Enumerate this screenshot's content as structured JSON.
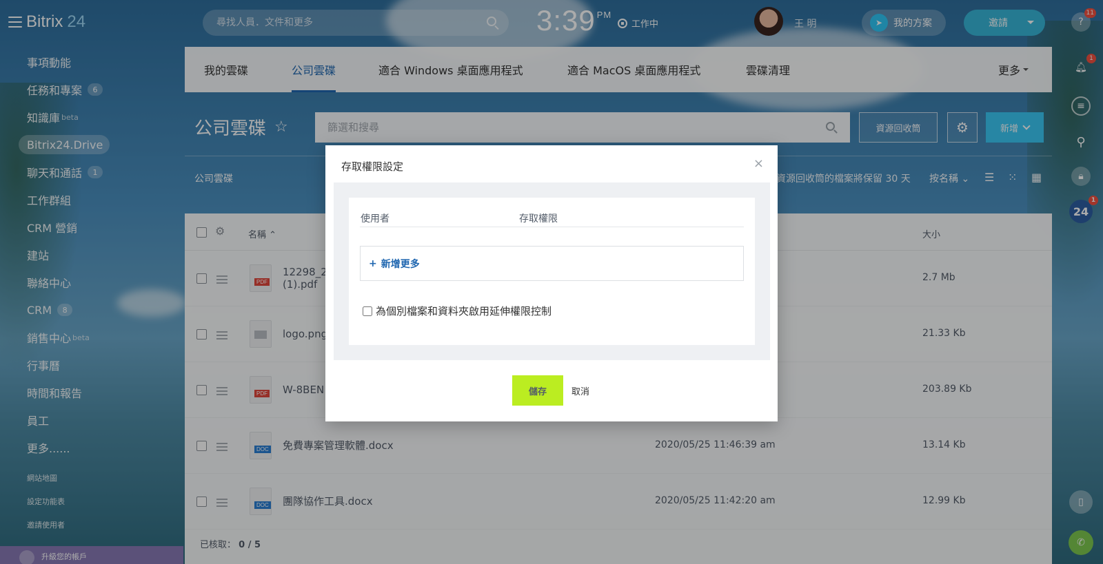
{
  "topbar": {
    "brand_main": "Bitrix",
    "brand_num": "24",
    "search_placeholder": "尋找人員．文件和更多",
    "clock_time": "3:39",
    "clock_ampm": "PM",
    "work_status": "工作中",
    "username": "王 明",
    "plan_label": "我的方案",
    "invite_label": "邀請"
  },
  "rail": {
    "help_badge": "11",
    "notify_badge": "1",
    "b24_label": "24",
    "b24_badge": "1"
  },
  "leftmenu": {
    "items": [
      {
        "label": "事項動能"
      },
      {
        "label": "任務和專案",
        "count": "6"
      },
      {
        "label": "知識庫",
        "sup": "beta"
      },
      {
        "label": "Bitrix24.Drive"
      },
      {
        "label": "聊天和通話",
        "count": "1"
      },
      {
        "label": "工作群組"
      },
      {
        "label": "CRM 營銷"
      },
      {
        "label": "建站"
      },
      {
        "label": "聯絡中心"
      },
      {
        "label": "CRM",
        "count": "8"
      },
      {
        "label": "銷售中心",
        "sup": "beta"
      },
      {
        "label": "行事曆"
      },
      {
        "label": "時間和報告"
      },
      {
        "label": "員工"
      },
      {
        "label": "更多......"
      }
    ],
    "sitemap": "網站地圖",
    "settings": "設定功能表",
    "invite_users": "邀請使用者",
    "upgrade": "升級您的帳戶"
  },
  "tabs": {
    "items": [
      "我的雲碟",
      "公司雲碟",
      "適合 Windows 桌面應用程式",
      "適合 MacOS 桌面應用程式",
      "雲碟清理"
    ],
    "more": "更多"
  },
  "page": {
    "title": "公司雲碟",
    "filter_placeholder": "篩選和搜尋",
    "recycle_btn": "資源回收筒",
    "new_btn": "新增",
    "breadcrumb": "公司雲碟",
    "keep_note": "資源回收筒的檔案將保留 30 天",
    "sort_label": "按名稱"
  },
  "table": {
    "col_name": "名稱",
    "col_size": "大小",
    "rows": [
      {
        "name1": "12298_2",
        "name2": "(1).pdf",
        "type": "PDF",
        "date": "",
        "size": "2.7 Mb"
      },
      {
        "name1": "logo.png",
        "name2": "",
        "type": "IMG",
        "date": "",
        "size": "21.33 Kb"
      },
      {
        "name1": "W-8BEN",
        "name2": "",
        "type": "PDF",
        "date": "",
        "size": "203.89 Kb"
      },
      {
        "name1": "免費專案管理軟體.docx",
        "name2": "",
        "type": "DOC",
        "date": "2020/05/25 11:46:39 am",
        "size": "13.14 Kb"
      },
      {
        "name1": "團隊協作工具.docx",
        "name2": "",
        "type": "DOC",
        "date": "2020/05/25 11:42:20 am",
        "size": "12.99 Kb"
      }
    ],
    "selected_label": "已核取：",
    "selected_value": "0 / 5"
  },
  "dialog": {
    "title": "存取權限設定",
    "col_user": "使用者",
    "col_access": "存取權限",
    "add_more": "新增更多",
    "extended_label": "為個別檔案和資料夾啟用延伸權限控制",
    "save": "儲存",
    "cancel": "取消"
  },
  "colors": {
    "accent_blue": "#2067b0",
    "save_green": "#bbed21",
    "new_button": "#3bc8f5",
    "badge_red": "#f25140"
  }
}
